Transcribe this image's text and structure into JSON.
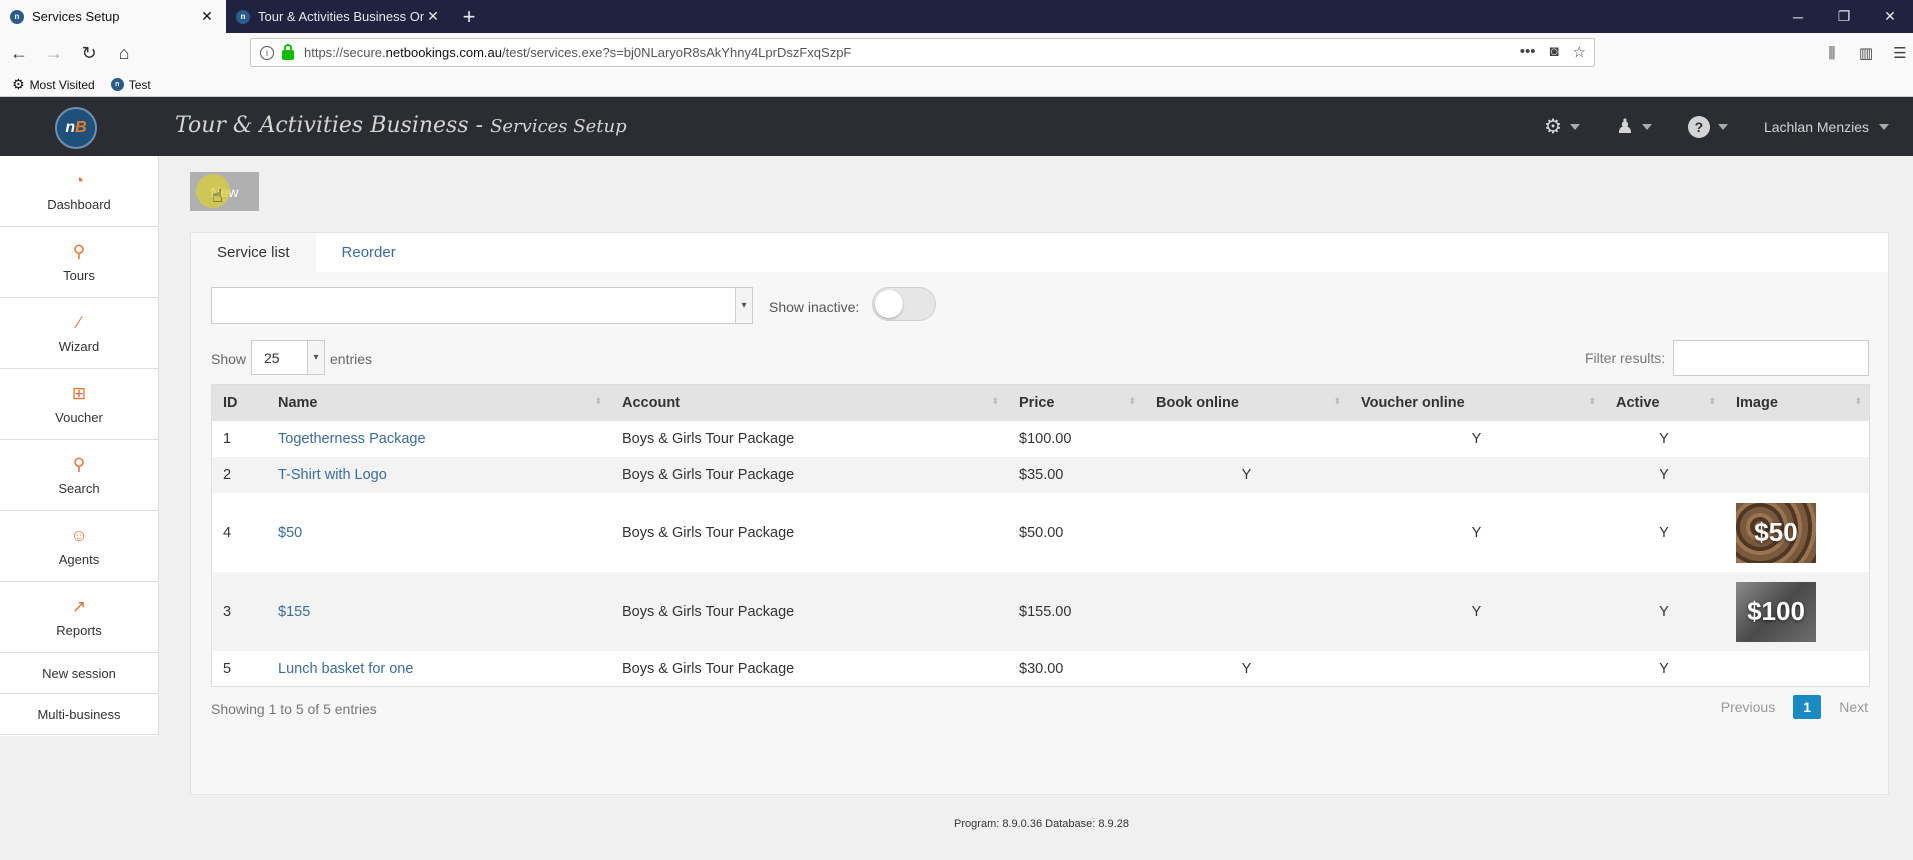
{
  "browser": {
    "tabs": [
      {
        "title": "Services Setup",
        "active": true
      },
      {
        "title": "Tour & Activities Business Onli",
        "active": false
      }
    ],
    "url_prefix": "https://secure.",
    "url_domain": "netbookings.com.au",
    "url_rest": "/test/services.exe?s=bj0NLaryoR8sAkYhny4LprDszFxqSzpF",
    "bookmarks": [
      {
        "label": "Most Visited",
        "icon": "gear-icon"
      },
      {
        "label": "Test",
        "icon": "nb-favicon"
      }
    ]
  },
  "header": {
    "logo_text": "nB",
    "title": "Tour & Activities Business",
    "separator": " - ",
    "subtitle": "Services Setup",
    "user_name": "Lachlan Menzies"
  },
  "sidebar": {
    "items": [
      {
        "label": "Dashboard",
        "icon": "dashboard-icon"
      },
      {
        "label": "Tours",
        "icon": "tours-icon"
      },
      {
        "label": "Wizard",
        "icon": "wizard-icon"
      },
      {
        "label": "Voucher",
        "icon": "gift-icon"
      },
      {
        "label": "Search",
        "icon": "search-icon"
      },
      {
        "label": "Agents",
        "icon": "agent-icon"
      },
      {
        "label": "Reports",
        "icon": "chart-icon"
      }
    ],
    "links": [
      {
        "label": "New session"
      },
      {
        "label": "Multi-business"
      }
    ]
  },
  "main": {
    "new_button": "New",
    "tabs": [
      {
        "label": "Service list",
        "active": true
      },
      {
        "label": "Reorder",
        "active": false
      }
    ],
    "show_inactive_label": "Show inactive:",
    "show_label": "Show",
    "entries_value": "25",
    "entries_label": "entries",
    "filter_label": "Filter results:",
    "columns": [
      "ID",
      "Name",
      "Account",
      "Price",
      "Book online",
      "Voucher online",
      "Active",
      "Image"
    ],
    "rows": [
      {
        "id": "1",
        "name": "Togetherness Package",
        "account": "Boys & Girls Tour Package",
        "price": "$100.00",
        "book_online": "",
        "voucher_online": "Y",
        "active": "Y",
        "image": ""
      },
      {
        "id": "2",
        "name": "T-Shirt with Logo",
        "account": "Boys & Girls Tour Package",
        "price": "$35.00",
        "book_online": "Y",
        "voucher_online": "",
        "active": "Y",
        "image": ""
      },
      {
        "id": "4",
        "name": "$50",
        "account": "Boys & Girls Tour Package",
        "price": "$50.00",
        "book_online": "",
        "voucher_online": "Y",
        "active": "Y",
        "image": "$50"
      },
      {
        "id": "3",
        "name": "$155",
        "account": "Boys & Girls Tour Package",
        "price": "$155.00",
        "book_online": "",
        "voucher_online": "Y",
        "active": "Y",
        "image": "$100"
      },
      {
        "id": "5",
        "name": "Lunch basket for one",
        "account": "Boys & Girls Tour Package",
        "price": "$30.00",
        "book_online": "Y",
        "voucher_online": "",
        "active": "Y",
        "image": ""
      }
    ],
    "showing_text": "Showing 1 to 5 of 5 entries",
    "pager": {
      "previous": "Previous",
      "current": "1",
      "next": "Next"
    }
  },
  "footer": {
    "text": "Program: 8.9.0.36 Database: 8.9.28"
  },
  "colors": {
    "header_bg": "#2b2d33",
    "accent_orange": "#e8733a",
    "link_blue": "#3a6d9e",
    "pager_active": "#1a8bc1"
  }
}
